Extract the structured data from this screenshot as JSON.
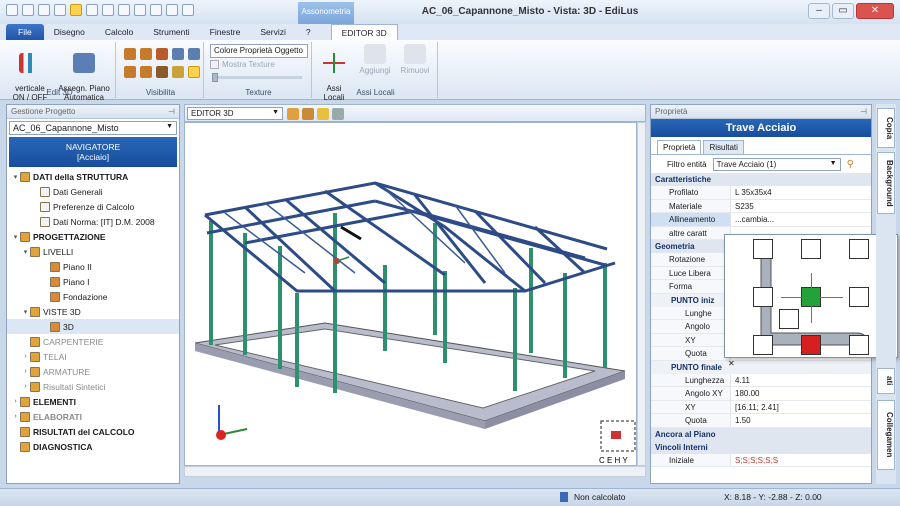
{
  "title": {
    "window": "AC_06_Capannone_Misto  -  Vista: 3D - EdiLus",
    "context_tab": "Assonometria"
  },
  "menu": [
    "File",
    "Disegno",
    "Calcolo",
    "Strumenti",
    "Finestre",
    "Servizi",
    "?",
    "EDITOR 3D"
  ],
  "ribbon": {
    "verticale": "verticale\nON / OFF",
    "assegn": "Assegn. Piano\nAutomatica",
    "group_edit": "Edit 3D",
    "group_visibilita": "Visibilita",
    "color_combo": "Colore Proprietà Oggetto",
    "mostra_texture": "Mostra Texture",
    "group_texture": "Texture",
    "assi_locali": "Assi\nLocali",
    "aggiungi": "Aggiungi",
    "rimuovi": "Rimuovi",
    "group_assi": "Assi Locali"
  },
  "left_panel": {
    "header": "Gestione Progetto",
    "project": "AC_06_Capannone_Misto",
    "navigator": "NAVIGATORE",
    "navigator_sub": "[Acciaio]",
    "tree": [
      {
        "label": "DATI della STRUTTURA",
        "indent": 0,
        "exp": "▾",
        "state": ""
      },
      {
        "label": "Dati Generali",
        "indent": 2,
        "exp": "",
        "state": ""
      },
      {
        "label": "Preferenze di Calcolo",
        "indent": 2,
        "exp": "",
        "state": ""
      },
      {
        "label": "Dati Norma: [IT] D.M. 2008",
        "indent": 2,
        "exp": "",
        "state": ""
      },
      {
        "label": "PROGETTAZIONE",
        "indent": 0,
        "exp": "▾",
        "state": ""
      },
      {
        "label": "LIVELLI",
        "indent": 1,
        "exp": "▾",
        "state": ""
      },
      {
        "label": "Piano II",
        "indent": 3,
        "exp": "",
        "state": ""
      },
      {
        "label": "Piano I",
        "indent": 3,
        "exp": "",
        "state": ""
      },
      {
        "label": "Fondazione",
        "indent": 3,
        "exp": "",
        "state": ""
      },
      {
        "label": "VISTE 3D",
        "indent": 1,
        "exp": "▾",
        "state": ""
      },
      {
        "label": "3D",
        "indent": 3,
        "exp": "",
        "state": "sel"
      },
      {
        "label": "CARPENTERIE",
        "indent": 1,
        "exp": "",
        "state": "gray"
      },
      {
        "label": "TELAI",
        "indent": 1,
        "exp": "›",
        "state": "gray"
      },
      {
        "label": "ARMATURE",
        "indent": 1,
        "exp": "›",
        "state": "gray"
      },
      {
        "label": "Risultati Sintetici",
        "indent": 1,
        "exp": "›",
        "state": "gray"
      },
      {
        "label": "ELEMENTI",
        "indent": 0,
        "exp": "›",
        "state": ""
      },
      {
        "label": "ELABORATI",
        "indent": 0,
        "exp": "›",
        "state": "gray"
      },
      {
        "label": "RISULTATI del CALCOLO",
        "indent": 0,
        "exp": "",
        "state": ""
      },
      {
        "label": "DIAGNOSTICA",
        "indent": 0,
        "exp": "",
        "state": ""
      }
    ]
  },
  "view": {
    "combo": "EDITOR 3D",
    "cube_label": "C E H Y"
  },
  "properties": {
    "header": "Proprietà",
    "title": "Trave Acciaio",
    "tabs": [
      "Proprietà",
      "Risultati"
    ],
    "filter_label": "Filtro entità",
    "filter_value": "Trave Acciaio (1)",
    "caratteristiche": "Caratteristiche",
    "rows1": [
      {
        "k": "Profilato",
        "v": "L 35x35x4"
      },
      {
        "k": "Materiale",
        "v": "S235"
      },
      {
        "k": "Allineamento",
        "v": "...cambia..."
      },
      {
        "k": "altre caratt",
        "v": ""
      }
    ],
    "geometria": "Geometria",
    "rows2": [
      {
        "k": "Rotazione",
        "v": ""
      },
      {
        "k": "Luce Libera",
        "v": ""
      },
      {
        "k": "Forma",
        "v": ""
      }
    ],
    "punto_iniziale": "PUNTO iniz",
    "rows3": [
      {
        "k": "Lunghe",
        "v": ""
      },
      {
        "k": "Angolo",
        "v": ""
      },
      {
        "k": "XY",
        "v": ""
      },
      {
        "k": "Quota",
        "v": ""
      }
    ],
    "punto_finale": "PUNTO finale",
    "rows4": [
      {
        "k": "Lunghezza",
        "v": "4.11"
      },
      {
        "k": "Angolo XY",
        "v": "180.00"
      },
      {
        "k": "XY",
        "v": "[16.11; 2.41]"
      },
      {
        "k": "Quota",
        "v": "1.50"
      }
    ],
    "ancora": "Ancora al Piano",
    "vincoli": "Vincoli Interni",
    "iniziale_k": "Iniziale",
    "iniziale_v": "S;S;S;S;S;S"
  },
  "side_tabs": [
    "Copia",
    "Background",
    "Collegamen"
  ],
  "side_mid": "ati",
  "status": {
    "calc": "Non calcolato",
    "coords": "X: 8.18 - Y: -2.88 - Z: 0.00"
  }
}
